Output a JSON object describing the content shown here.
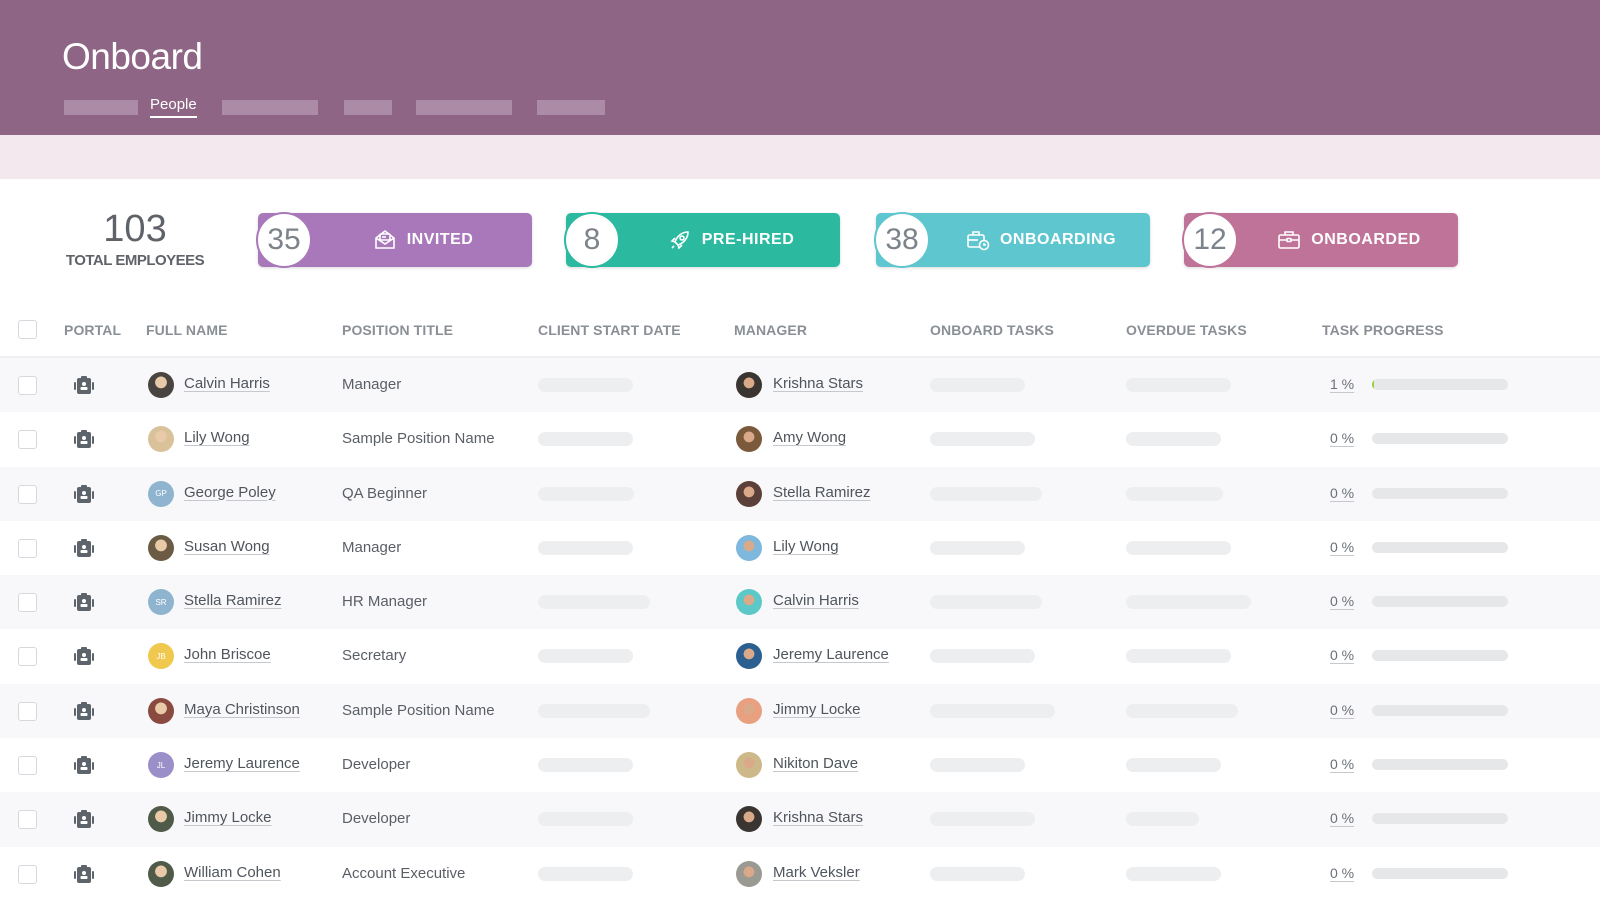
{
  "app": {
    "title": "Onboard",
    "nav": {
      "active_label": "People"
    }
  },
  "summary": {
    "total_count": "103",
    "total_label": "TOTAL EMPLOYEES",
    "stats": [
      {
        "count": "35",
        "label": "INVITED",
        "icon": "envelope-open-icon",
        "color": "#a878ba"
      },
      {
        "count": "8",
        "label": "PRE-HIRED",
        "icon": "rocket-icon",
        "color": "#2bbaa0"
      },
      {
        "count": "38",
        "label": "ONBOARDING",
        "icon": "briefcase-clock-icon",
        "color": "#5ec6cf"
      },
      {
        "count": "12",
        "label": "ONBOARDED",
        "icon": "briefcase-icon",
        "color": "#c07399"
      }
    ]
  },
  "table": {
    "columns": [
      "PORTAL",
      "FULL NAME",
      "POSITION TITLE",
      "CLIENT START DATE",
      "MANAGER",
      "ONBOARD TASKS",
      "OVERDUE TASKS",
      "TASK PROGRESS"
    ],
    "rows": [
      {
        "name": "Calvin Harris",
        "avatar": {
          "type": "photo",
          "color": "#4a4440"
        },
        "position": "Manager",
        "manager": "Krishna Stars",
        "manager_avatar_color": "#3b3532",
        "progress": 1,
        "progress_label": "1 %"
      },
      {
        "name": "Lily Wong",
        "avatar": {
          "type": "photo",
          "color": "#d9c29a"
        },
        "position": "Sample Position Name",
        "manager": "Amy Wong",
        "manager_avatar_color": "#7a5a3a",
        "progress": 0,
        "progress_label": "0 %"
      },
      {
        "name": "George Poley",
        "avatar": {
          "type": "initials",
          "initials": "GP",
          "color": "#8fb4cf"
        },
        "position": "QA Beginner",
        "manager": "Stella Ramirez",
        "manager_avatar_color": "#5a4038",
        "progress": 0,
        "progress_label": "0 %"
      },
      {
        "name": "Susan Wong",
        "avatar": {
          "type": "photo",
          "color": "#6b5a44"
        },
        "position": "Manager",
        "manager": "Lily Wong",
        "manager_avatar_color": "#7fb8dd",
        "progress": 0,
        "progress_label": "0 %"
      },
      {
        "name": "Stella Ramirez",
        "avatar": {
          "type": "initials",
          "initials": "SR",
          "color": "#8fb4cf"
        },
        "position": "HR Manager",
        "manager": "Calvin Harris",
        "manager_avatar_color": "#5dc8c8",
        "progress": 0,
        "progress_label": "0 %"
      },
      {
        "name": "John Briscoe",
        "avatar": {
          "type": "initials",
          "initials": "JB",
          "color": "#f0c84e"
        },
        "position": "Secretary",
        "manager": "Jeremy Laurence",
        "manager_avatar_color": "#2a5f8f",
        "progress": 0,
        "progress_label": "0 %"
      },
      {
        "name": "Maya Christinson",
        "avatar": {
          "type": "photo",
          "color": "#8a4a40"
        },
        "position": "Sample Position Name",
        "manager": "Jimmy Locke",
        "manager_avatar_color": "#e9a080",
        "progress": 0,
        "progress_label": "0 %"
      },
      {
        "name": "Jeremy Laurence",
        "avatar": {
          "type": "initials",
          "initials": "JL",
          "color": "#9a8fc8"
        },
        "position": "Developer",
        "manager": "Nikiton Dave",
        "manager_avatar_color": "#cdb88a",
        "progress": 0,
        "progress_label": "0 %"
      },
      {
        "name": "Jimmy Locke",
        "avatar": {
          "type": "photo",
          "color": "#4f5a48"
        },
        "position": "Developer",
        "manager": "Krishna Stars",
        "manager_avatar_color": "#3b3532",
        "progress": 0,
        "progress_label": "0 %"
      },
      {
        "name": "William Cohen",
        "avatar": {
          "type": "photo",
          "color": "#4f5a48"
        },
        "position": "Account Executive",
        "manager": "Mark Veksler",
        "manager_avatar_color": "#9a9a92",
        "progress": 0,
        "progress_label": "0 %"
      }
    ]
  }
}
